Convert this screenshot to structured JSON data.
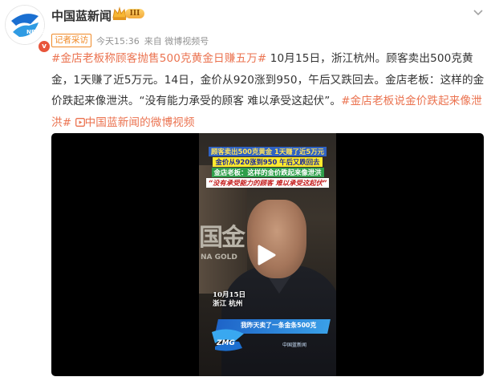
{
  "account": {
    "name": "中国蓝新闻",
    "verified_badge": "v",
    "level_badge": "III",
    "identity_tag": "记者采访",
    "time": "今天15:36",
    "source": "来自 微博视频号"
  },
  "post": {
    "hashtag_title": "#金店老板称顾客抛售500克黄金日赚五万#",
    "body": " 10月15日，浙江杭州。顾客卖出500克黄金，1天赚了近5万元。14日，金价从920涨到950，午后又跌回去。金店老板：这样的金价跌起来像泄洪。“没有能力承受的顾客 难以承受这起伏”。",
    "hashtag_2": "#金店老板说金价跌起来像泄洪#",
    "video_link_icon": "video-link-icon",
    "video_link": "中国蓝新闻的微博视频"
  },
  "video": {
    "caption_1": "顾客卖出500克黄金 1天赚了近5万元",
    "caption_2": "金价从920涨到950 午后又跌回去",
    "caption_3": "金店老板：这样的金价跌起来像泄洪",
    "caption_4": "“没有承受能力的顾客 难以承受这起伏”",
    "sign_text": "国金",
    "sign_sub": "NA GOLD",
    "date_stamp": "10月15日",
    "location_stamp": "浙江 杭州",
    "lower_third": "我昨天卖了一条金条500克",
    "lower_logo_text": "ZMG",
    "lower_brand": "中国蓝新闻"
  },
  "colors": {
    "link": "#eb7350",
    "tag": "#f08a28",
    "muted": "#939393"
  }
}
